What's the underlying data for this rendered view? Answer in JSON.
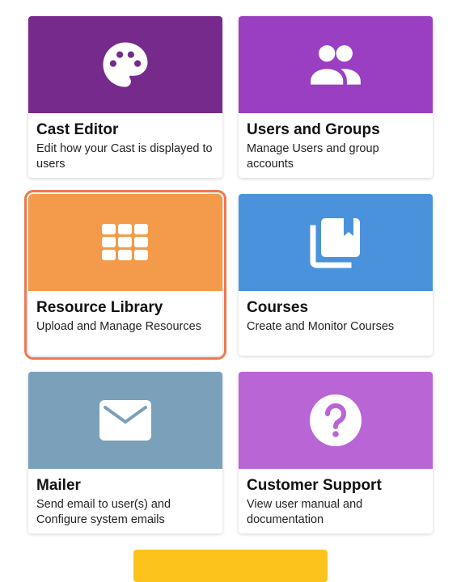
{
  "cards": [
    {
      "title": "Cast Editor",
      "description": "Edit how your Cast is displayed to users",
      "color": "#752a8c",
      "icon": "palette-icon"
    },
    {
      "title": "Users and Groups",
      "description": "Manage Users and group accounts",
      "color": "#9a3fc2",
      "icon": "users-icon"
    },
    {
      "title": "Resource Library",
      "description": "Upload and Manage Resources",
      "color": "#f39b4a",
      "icon": "grid-icon",
      "selected": true
    },
    {
      "title": "Courses",
      "description": "Create and Monitor Courses",
      "color": "#4a93dc",
      "icon": "library-books-icon"
    },
    {
      "title": "Mailer",
      "description": "Send email to user(s) and Configure system emails",
      "color": "#7aa1b9",
      "icon": "mail-icon"
    },
    {
      "title": "Customer Support",
      "description": "View user manual and documentation",
      "color": "#b965d6",
      "icon": "help-icon"
    }
  ],
  "colors": {
    "selected_outline": "#f0784f",
    "bottom_button": "#fbc31b"
  }
}
